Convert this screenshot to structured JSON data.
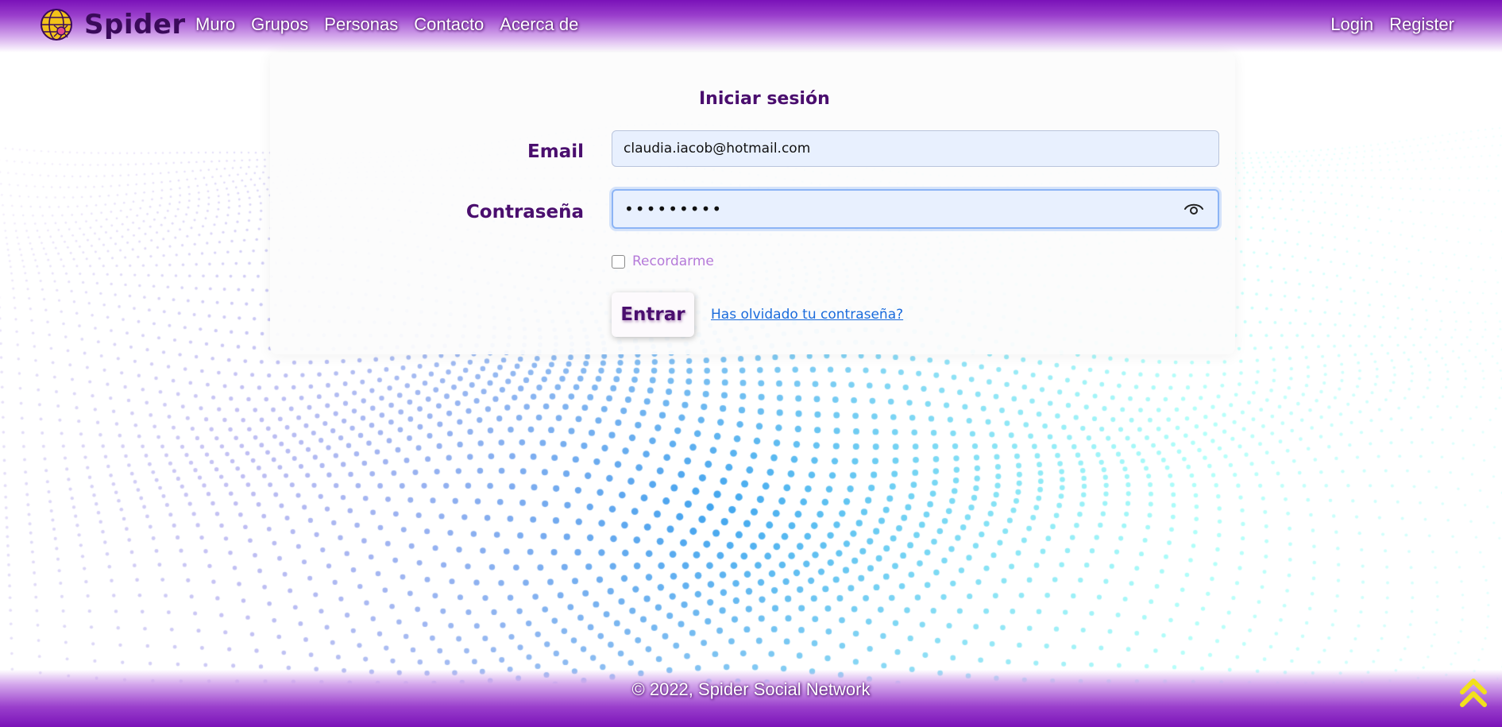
{
  "navbar": {
    "brand": "Spider",
    "links": [
      "Muro",
      "Grupos",
      "Personas",
      "Contacto",
      "Acerca de"
    ],
    "login_label": "Login",
    "register_label": "Register"
  },
  "login_form": {
    "title": "Iniciar sesión",
    "email_label": "Email",
    "email_value": "claudia.iacob@hotmail.com",
    "password_label": "Contraseña",
    "password_value": "•••••••••",
    "remember_label": "Recordarme",
    "remember_checked": false,
    "submit_label": "Entrar",
    "forgot_label": "Has olvidado tu contraseña?"
  },
  "footer": {
    "copyright": "© 2022, Spider Social Network"
  },
  "icons": {
    "logo": "globe-spider-icon",
    "show_password": "eye-icon",
    "back_to_top": "double-chevron-up-icon"
  },
  "colors": {
    "brand_purple": "#7a12b8",
    "heading_purple": "#4a0e6e",
    "link_blue": "#1a6bdc",
    "accent_yellow": "#f2e01c"
  }
}
